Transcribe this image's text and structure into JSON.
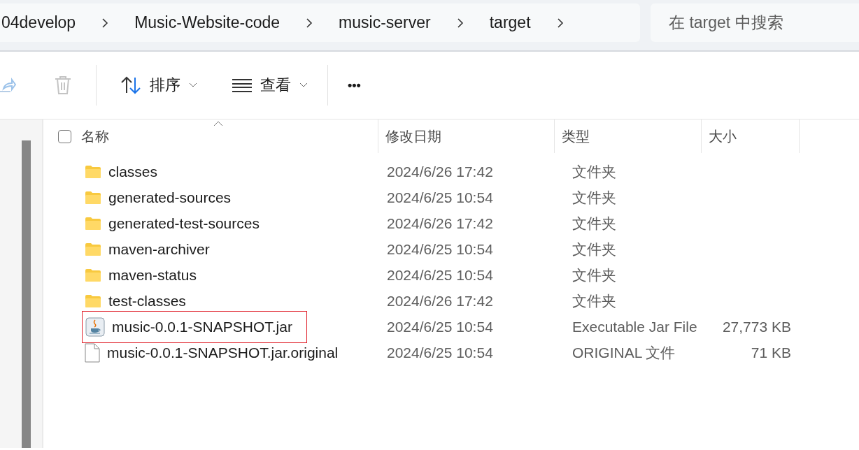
{
  "breadcrumb": [
    "04develop",
    "Music-Website-code",
    "music-server",
    "target"
  ],
  "search": {
    "placeholder": "在 target 中搜索"
  },
  "toolbar": {
    "sort": "排序",
    "view": "查看",
    "more": "•••"
  },
  "select_all": {
    "checked": false
  },
  "columns": [
    "名称",
    "修改日期",
    "类型",
    "大小"
  ],
  "rows": [
    {
      "kind": "folder",
      "name": "classes",
      "date": "2024/6/26 17:42",
      "type": "文件夹",
      "highlighted": false
    },
    {
      "kind": "folder",
      "name": "generated-sources",
      "date": "2024/6/25 10:54",
      "type": "文件夹",
      "highlighted": false
    },
    {
      "kind": "folder",
      "name": "generated-test-sources",
      "date": "2024/6/26 17:42",
      "type": "文件夹",
      "highlighted": false
    },
    {
      "kind": "folder",
      "name": "maven-archiver",
      "date": "2024/6/25 10:54",
      "type": "文件夹",
      "highlighted": false
    },
    {
      "kind": "folder",
      "name": "maven-status",
      "date": "2024/6/25 10:54",
      "type": "文件夹",
      "highlighted": false
    },
    {
      "kind": "folder",
      "name": "test-classes",
      "date": "2024/6/26 17:42",
      "type": "文件夹",
      "highlighted": false
    },
    {
      "kind": "jar",
      "name": "music-0.0.1-SNAPSHOT.jar",
      "date": "2024/6/25 10:54",
      "type": "Executable Jar File",
      "size": "27,773 KB",
      "highlighted": true
    },
    {
      "kind": "file",
      "name": "music-0.0.1-SNAPSHOT.jar.original",
      "date": "2024/6/25 10:54",
      "type": "ORIGINAL 文件",
      "size": "71 KB",
      "highlighted": false
    }
  ]
}
